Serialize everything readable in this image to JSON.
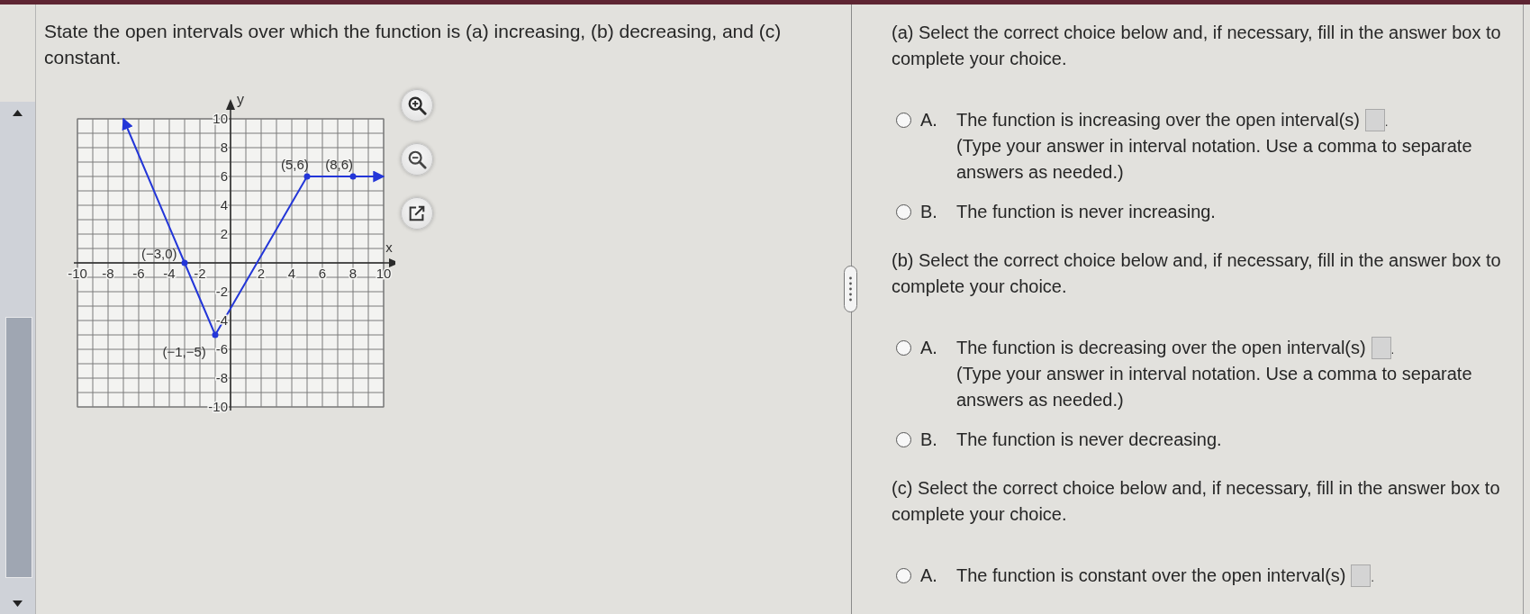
{
  "question": {
    "text": "State the open intervals over which the function is (a) increasing, (b) decreasing, and (c) constant."
  },
  "graph": {
    "chart_data": {
      "type": "line",
      "xlabel": "x",
      "ylabel": "y",
      "x": [
        -7,
        -3,
        -1,
        5,
        8,
        10
      ],
      "series": [
        {
          "color": "#2336d8",
          "values": [
            10,
            0,
            -5,
            6,
            6,
            6
          ]
        }
      ],
      "xlim": [
        -10,
        10
      ],
      "ylim": [
        -10,
        10
      ],
      "xticks": [
        -10,
        -8,
        -6,
        -4,
        -2,
        2,
        4,
        6,
        8,
        10
      ],
      "yticks": [
        -10,
        -8,
        -6,
        -4,
        -2,
        2,
        4,
        6,
        8,
        10
      ],
      "grid": true,
      "annotations": [
        {
          "x": -3,
          "y": 0,
          "text": "(−3,0)"
        },
        {
          "x": -1,
          "y": -5,
          "text": "(−1,−5)"
        },
        {
          "x": 5,
          "y": 6,
          "text": "(5,6)"
        },
        {
          "x": 8,
          "y": 6,
          "text": "(8,6)"
        }
      ]
    }
  },
  "parts": [
    {
      "prompt": "(a) Select the correct choice below and, if necessary, fill in the answer box to complete your choice.",
      "choices": [
        {
          "kind": "input",
          "letter": "A.",
          "text": "The function is increasing over the open interval(s)",
          "after": ".",
          "hint": "(Type your answer in interval notation. Use a comma to separate answers as needed.)",
          "selected": false
        },
        {
          "kind": "plain",
          "letter": "B.",
          "text": "The function is never increasing.",
          "selected": false
        }
      ]
    },
    {
      "prompt": "(b) Select the correct choice below and, if necessary, fill in the answer box to complete your choice.",
      "choices": [
        {
          "kind": "input",
          "letter": "A.",
          "text": "The function is decreasing over the open interval(s)",
          "after": ".",
          "hint": "(Type your answer in interval notation. Use a comma to separate answers as needed.)",
          "selected": false
        },
        {
          "kind": "plain",
          "letter": "B.",
          "text": "The function is never decreasing.",
          "selected": false
        }
      ]
    },
    {
      "prompt": "(c) Select the correct choice below and, if necessary, fill in the answer box to complete your choice.",
      "choices": [
        {
          "kind": "input",
          "letter": "A.",
          "text": "The function is constant over the open interval(s)",
          "after": ".",
          "selected": false
        }
      ]
    }
  ]
}
